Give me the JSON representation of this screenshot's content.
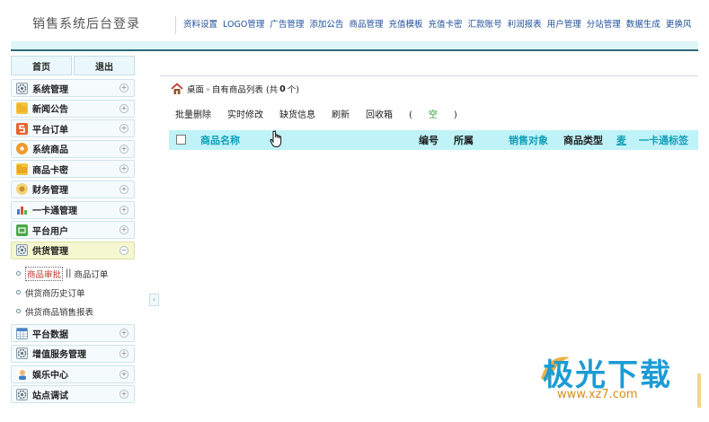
{
  "app": {
    "title": "销售系统后台登录"
  },
  "top_nav": [
    "资料设置",
    "LOGO管理",
    "广告管理",
    "添加公告",
    "商品管理",
    "充值模板",
    "充值卡密",
    "汇款账号",
    "利润报表",
    "用户管理",
    "分站管理",
    "数据生成",
    "更换风"
  ],
  "sidebar": {
    "home_label": "首页",
    "logout_label": "退出",
    "menu": [
      {
        "label": "系统管理",
        "icon": "gear-icon",
        "toggle": "+"
      },
      {
        "label": "新闻公告",
        "icon": "folder-icon",
        "toggle": "+"
      },
      {
        "label": "平台订单",
        "icon": "order-icon",
        "toggle": "+"
      },
      {
        "label": "系统商品",
        "icon": "product-icon",
        "toggle": "+"
      },
      {
        "label": "商品卡密",
        "icon": "card-icon",
        "toggle": "+"
      },
      {
        "label": "财务管理",
        "icon": "finance-icon",
        "toggle": "+"
      },
      {
        "label": "一卡通管理",
        "icon": "chart-icon",
        "toggle": "+"
      },
      {
        "label": "平台用户",
        "icon": "user-platform-icon",
        "toggle": "+"
      },
      {
        "label": "供货管理",
        "icon": "gear-icon",
        "toggle": "−"
      }
    ],
    "submenu": {
      "audit_label": "商品审批",
      "separator": "||",
      "orders_label": "商品订单",
      "history_label": "供货商历史订单",
      "report_label": "供货商品销售报表"
    },
    "menu_after": [
      {
        "label": "平台数据",
        "icon": "calendar-icon",
        "toggle": "+"
      },
      {
        "label": "增值服务管理",
        "icon": "gear-icon",
        "toggle": "+"
      },
      {
        "label": "娱乐中心",
        "icon": "person-icon",
        "toggle": "+"
      },
      {
        "label": "站点调试",
        "icon": "gear-icon",
        "toggle": "+"
      }
    ],
    "collapse_glyph": "‹"
  },
  "breadcrumb": {
    "home": "桌面",
    "sep": "»",
    "page": "自有商品列表",
    "count_prefix": "(共",
    "count": "0",
    "count_suffix": "个)"
  },
  "toolbar": {
    "batch_delete": "批量删除",
    "live_edit": "实时修改",
    "out_of_stock": "缺货信息",
    "refresh": "刷新",
    "recycle": "回收箱",
    "recycle_open": "(",
    "recycle_count": "空",
    "recycle_close": ")"
  },
  "table": {
    "columns": {
      "name": "商品名称",
      "code": "编号",
      "belong": "所属",
      "target": "销售对象",
      "type": "商品类型",
      "price": "麦",
      "label": "一卡通标签"
    }
  },
  "watermark": {
    "brand": "极光下载",
    "url": "www.xz7.com"
  },
  "colors": {
    "accent": "#10a0b8",
    "header_rule": "#2e6a78",
    "table_header_bg": "#bff3f8",
    "watermark_blue": "#1c9bd4",
    "watermark_orange": "#d68f1a"
  }
}
